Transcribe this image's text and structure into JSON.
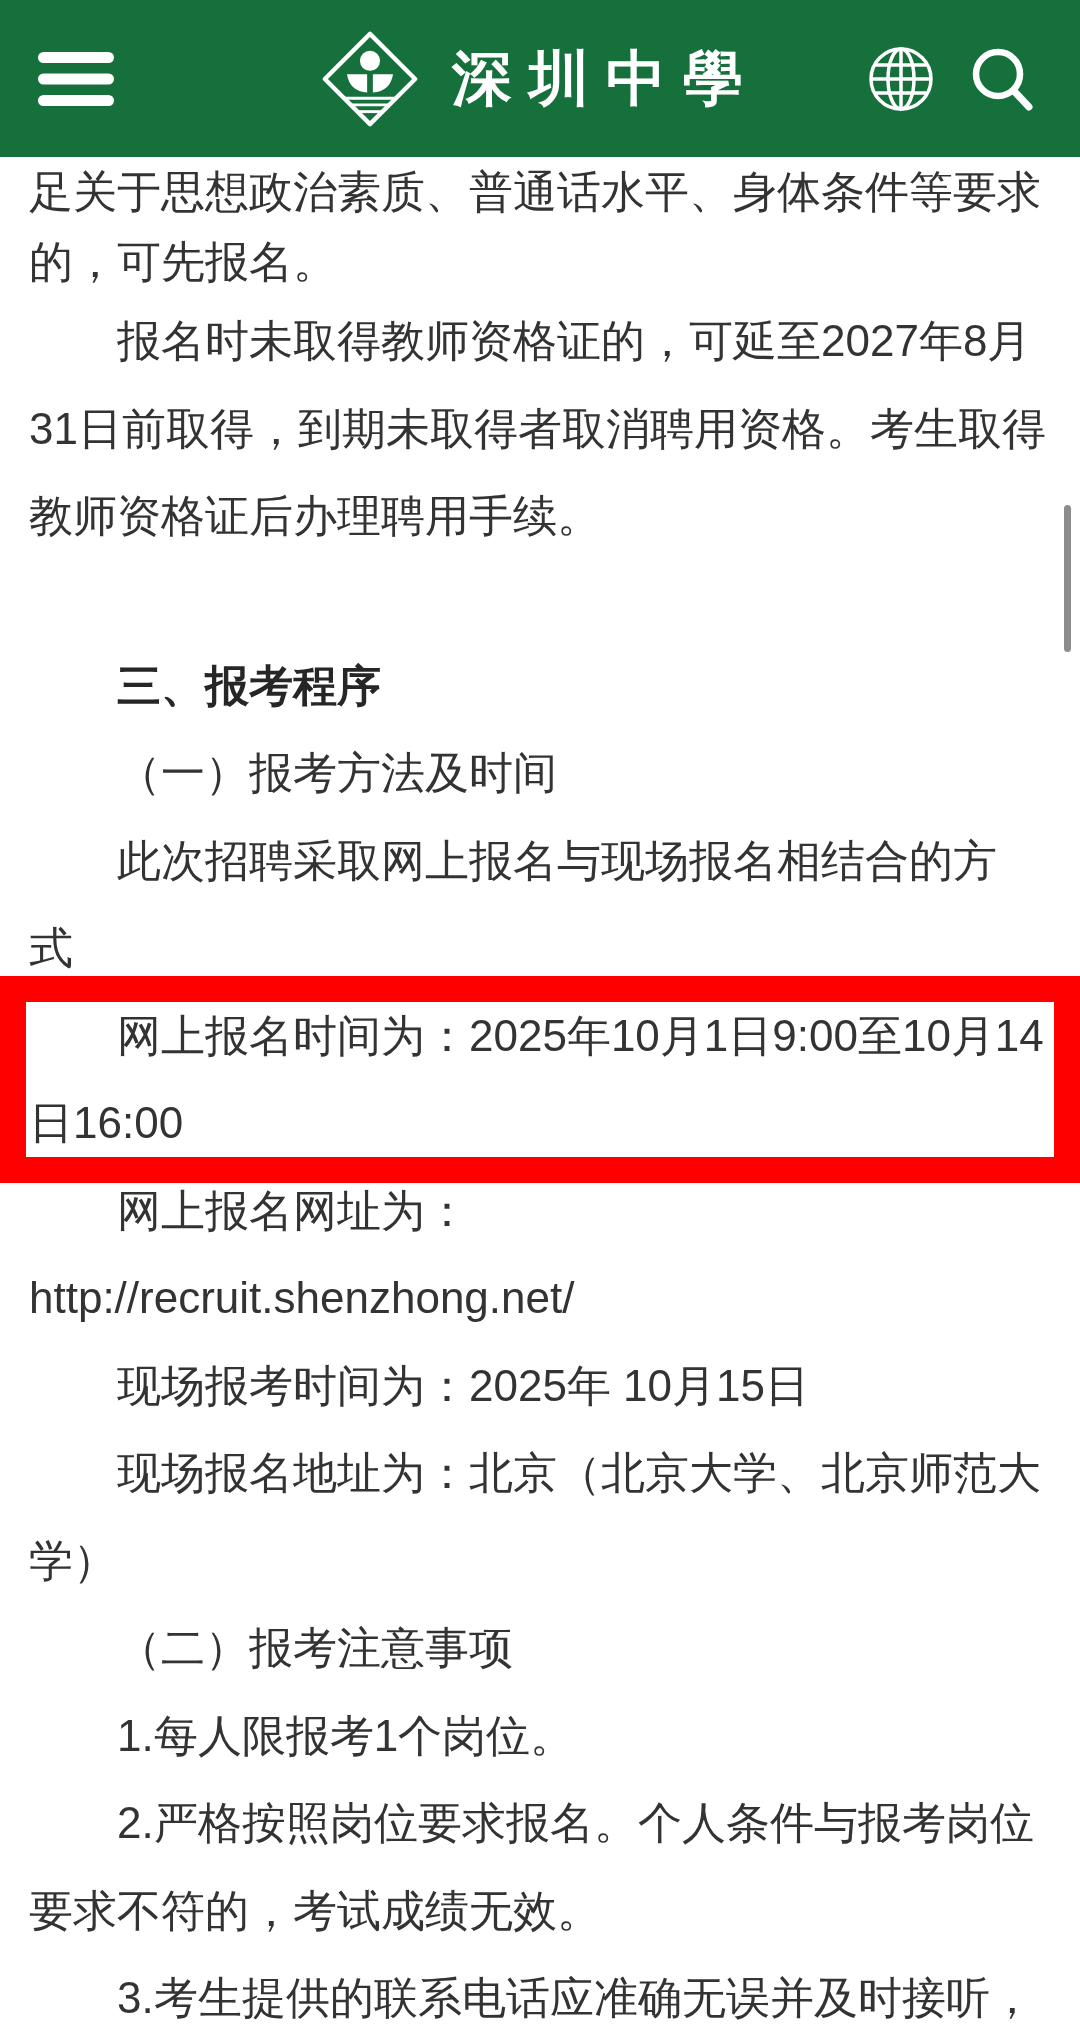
{
  "header": {
    "logo_text": "深圳中學"
  },
  "article": {
    "paragraphs": [
      {
        "kind": "continued",
        "highlighted": false,
        "lines": [
          "足关于思想政治素质、普通话水平、身体条件等要求",
          "的，可先报名。"
        ]
      },
      {
        "kind": "body",
        "highlighted": false,
        "lines": [
          "报名时未取得教师资格证的，可延至2027年8月",
          "31日前取得，到期未取得者取消聘用资格。考生取得",
          "教师资格证后办理聘用手续。"
        ]
      },
      {
        "kind": "heading",
        "highlighted": false,
        "lines": [
          "三、报考程序"
        ]
      },
      {
        "kind": "body",
        "highlighted": false,
        "lines": [
          "（一）报考方法及时间"
        ]
      },
      {
        "kind": "body",
        "highlighted": false,
        "lines": [
          "此次招聘采取网上报名与现场报名相结合的方",
          "式"
        ]
      },
      {
        "kind": "body",
        "highlighted": true,
        "lines": [
          "网上报名时间为：2025年10月1日9:00至10月14",
          "日16:00"
        ]
      },
      {
        "kind": "body",
        "highlighted": false,
        "lines": [
          "网上报名网址为：",
          "http://recruit.shenzhong.net/"
        ]
      },
      {
        "kind": "body",
        "highlighted": false,
        "lines": [
          "现场报考时间为：2025年 10月15日"
        ]
      },
      {
        "kind": "body",
        "highlighted": false,
        "lines": [
          "现场报名地址为：北京（北京大学、北京师范大",
          "学）"
        ]
      },
      {
        "kind": "body",
        "highlighted": false,
        "lines": [
          "（二）报考注意事项"
        ]
      },
      {
        "kind": "body",
        "highlighted": false,
        "lines": [
          "1.每人限报考1个岗位。"
        ]
      },
      {
        "kind": "body",
        "highlighted": false,
        "lines": [
          "2.严格按照岗位要求报名。个人条件与报考岗位",
          "要求不符的，考试成绩无效。"
        ]
      },
      {
        "kind": "body",
        "highlighted": false,
        "lines": [
          "3.考生提供的联系电话应准确无误并及时接听，"
        ]
      }
    ]
  }
}
